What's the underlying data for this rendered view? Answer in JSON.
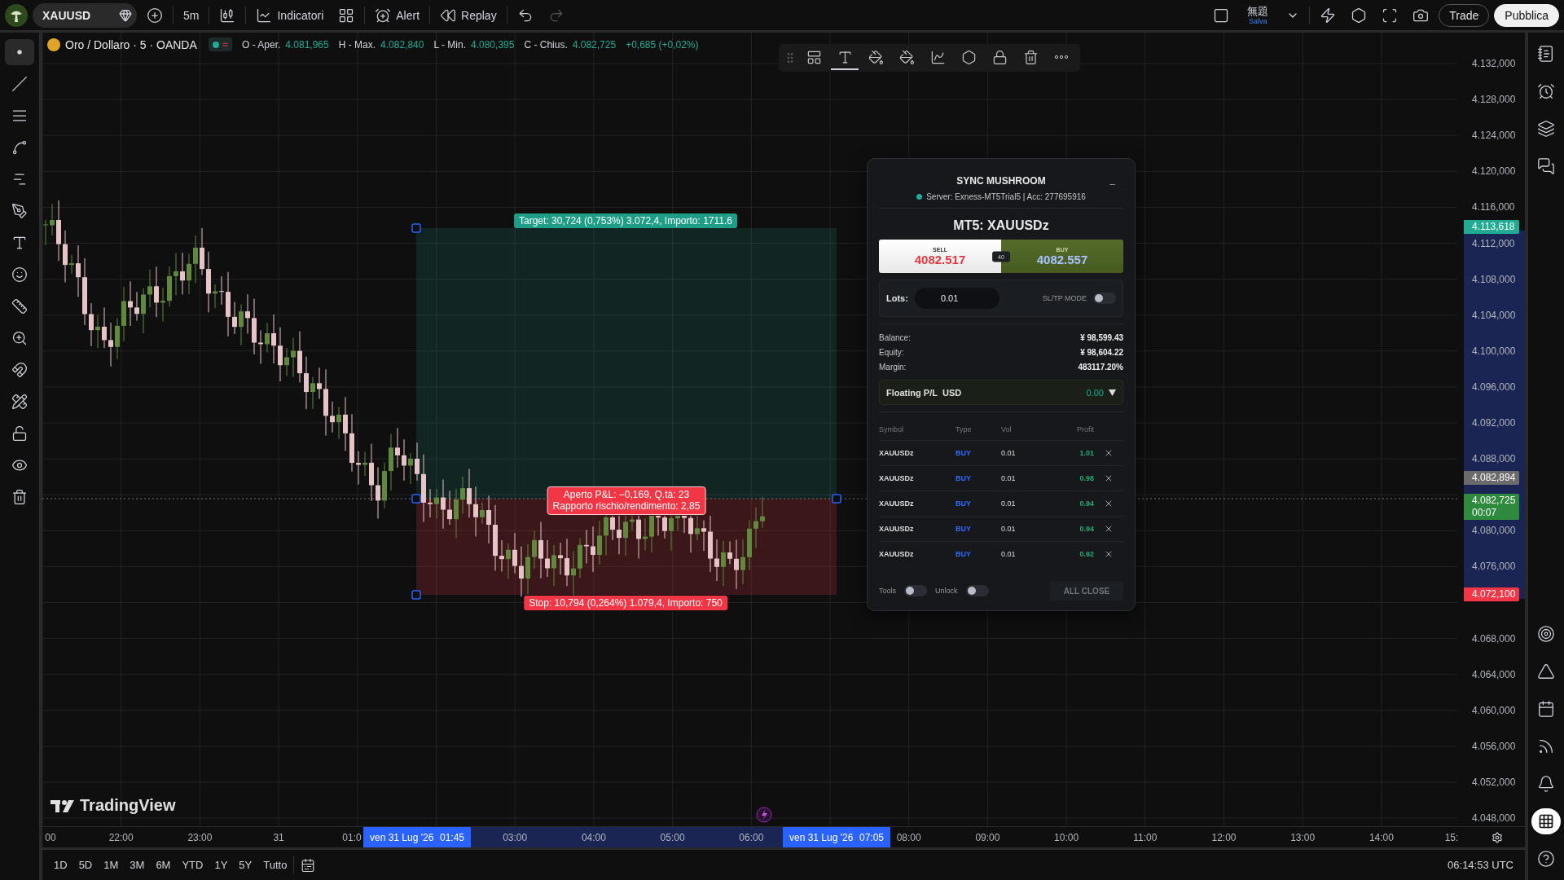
{
  "top_bar": {
    "symbol": "XAUUSD",
    "interval": "5m",
    "buttons": [
      {
        "kind": "indicators",
        "label": "Indicatori"
      },
      {
        "kind": "alert",
        "label": "Alert"
      },
      {
        "kind": "replay",
        "label": "Replay"
      }
    ],
    "undo": {
      "disabled": false
    },
    "redo": {
      "disabled": true
    },
    "layout_name": "無題",
    "save_label": "Salva",
    "trade_label": "Trade",
    "publish_label": "Pubblica"
  },
  "legend": {
    "title": "Oro / Dollaro · 5 · OANDA",
    "status_badge": "≈",
    "fields": [
      {
        "label": "O - Aper.",
        "value": "4.081,965"
      },
      {
        "label": "H - Max.",
        "value": "4.082,840"
      },
      {
        "label": "L - Min.",
        "value": "4.080,395"
      },
      {
        "label": "C - Chius.",
        "value": "4.082,725"
      }
    ],
    "change": "+0,685 (+0,02%)"
  },
  "position": {
    "target_label": "Target: 30,724 (0,753%) 3.072,4, Importo: 1711.6",
    "stop_label": "Stop: 10,794 (0,264%) 1.079,4, Importo: 750",
    "pnl_lines": [
      "Aperto P&L: −0,169, Q.tà: 23",
      "Rapporto rischio/rendimento: 2,85"
    ]
  },
  "price_axis": {
    "ticks": [
      "4.132,000",
      "4.128,000",
      "4.124,000",
      "4.120,000",
      "4.116,000",
      "4.112,000",
      "4.108,000",
      "4.104,000",
      "4.100,000",
      "4.096,000",
      "4.092,000",
      "4.088,000",
      "4.080,000",
      "4.076,000",
      "4.068,000",
      "4.064,000",
      "4.060,000",
      "4.056,000",
      "4.052,000",
      "4.048,000"
    ],
    "markers": [
      {
        "kind": "target",
        "label": "4.113,618"
      },
      {
        "kind": "high",
        "label": "4.082,894"
      },
      {
        "kind": "last",
        "label": "4.082,725",
        "countdown": "00:07"
      },
      {
        "kind": "stop",
        "label": "4.072,100"
      }
    ]
  },
  "time_axis": {
    "ticks": [
      "00",
      "22:00",
      "23:00",
      "31",
      "01:0",
      "03:00",
      "04:00",
      "05:00",
      "06:00",
      "08:00",
      "09:00",
      "10:00",
      "11:00",
      "12:00",
      "13:00",
      "14:00",
      "15:"
    ],
    "cursor_labels": [
      {
        "date": "ven 31 Lug '26",
        "time": "01:45"
      },
      {
        "date": "ven 31 Lug '26",
        "time": "07:05"
      }
    ]
  },
  "brand": "TradingView",
  "ranges": [
    "1D",
    "5D",
    "1M",
    "3M",
    "6M",
    "YTD",
    "1Y",
    "5Y",
    "Tutto"
  ],
  "clock": "06:14:53 UTC",
  "panel": {
    "title": "SYNC MUSHROOM",
    "minimize": "–",
    "connected": true,
    "server": "Server: Exness-MT5Trial5 | Acc: 277695916",
    "symbol": "MT5: XAUUSDz",
    "sell": {
      "label": "SELL",
      "price": "4082.517"
    },
    "spread": "40",
    "buy": {
      "label": "BUY",
      "price": "4082.557"
    },
    "lots_label": "Lots:",
    "lots": "0.01",
    "sltp": {
      "label": "SL/TP MODE",
      "on": false
    },
    "account": [
      {
        "label": "Balance:",
        "value": "¥ 98,599.43"
      },
      {
        "label": "Equity:",
        "value": "¥ 98,604.22"
      },
      {
        "label": "Margin:",
        "value": "483117.20%"
      }
    ],
    "floating": {
      "label": "Floating P/L",
      "currency": "USD",
      "value": "0.00"
    },
    "columns": [
      "Symbol",
      "Type",
      "Vol",
      "Profit"
    ],
    "positions": [
      {
        "symbol": "XAUUSDz",
        "type": "BUY",
        "vol": "0.01",
        "profit": "1.01"
      },
      {
        "symbol": "XAUUSDz",
        "type": "BUY",
        "vol": "0.01",
        "profit": "0.98"
      },
      {
        "symbol": "XAUUSDz",
        "type": "BUY",
        "vol": "0.01",
        "profit": "0.94"
      },
      {
        "symbol": "XAUUSDz",
        "type": "BUY",
        "vol": "0.01",
        "profit": "0.94"
      },
      {
        "symbol": "XAUUSDz",
        "type": "BUY",
        "vol": "0.01",
        "profit": "0.92"
      }
    ],
    "tools": {
      "label": "Tools",
      "on": false
    },
    "unlock": {
      "label": "Unlock",
      "on": false
    },
    "close_all": {
      "label": "ALL CLOSE",
      "disabled": true
    }
  }
}
